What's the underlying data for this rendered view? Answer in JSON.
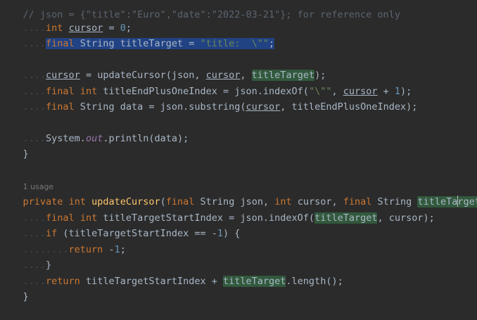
{
  "editor": {
    "language": "java",
    "colors": {
      "background": "#2b2b2b",
      "keyword": "#cc7832",
      "string": "#6a8759",
      "number": "#6897bb",
      "method": "#ffc66d",
      "selection": "#214283",
      "usage_highlight": "#32593d"
    },
    "lines": {
      "l0": "// json = {\"title\":\"Euro\",\"date\":\"2022-03-21\"}; for reference only",
      "l1": {
        "kw": "int",
        "var": "cursor",
        "rest": " = ",
        "num": "0",
        "end": ";"
      },
      "l2": {
        "kw": "final",
        "type": " String titleTarget = ",
        "str": "\"title:  \\\"\"",
        "end": ";"
      },
      "l4": {
        "var1": "cursor",
        "mid": " = updateCursor(json, ",
        "var2": "cursor",
        "sep": ", ",
        "hl": "titleTarget",
        "end": ");"
      },
      "l5": {
        "kw1": "final",
        "kw2": "int",
        "rest": " titleEndPlusOneIndex = json.indexOf(",
        "str": "\"\\\"\"",
        "sep": ", ",
        "var": "cursor",
        "plus": " + ",
        "num": "1",
        "end": ");"
      },
      "l6": {
        "kw": "final",
        "rest": " String data = json.substring(",
        "var": "cursor",
        "end": ", titleEndPlusOneIndex);"
      },
      "l8": {
        "pre": "System.",
        "ital": "out",
        "post": ".println(data);"
      },
      "l9": "}",
      "usage": "1 usage",
      "l11": {
        "kw1": "private",
        "kw2": "int",
        "fn": "updateCursor",
        "p1": "(",
        "kw3": "final",
        "p2": " String json, ",
        "kw4": "int",
        "p3": " cursor, ",
        "kw5": "final",
        "p4": " String ",
        "hl_a": "titleTa",
        "hl_b": "rget",
        "end": ") {"
      },
      "l12": {
        "kw1": "final",
        "kw2": "int",
        "rest": " titleTargetStartIndex = json.indexOf(",
        "hl": "titleTarget",
        "end": ", cursor);"
      },
      "l13": {
        "kw": "if",
        "rest": " (titleTargetStartIndex == -",
        "num": "1",
        "end": ") {"
      },
      "l14": {
        "kw": "return",
        "rest": " -",
        "num": "1",
        "end": ";"
      },
      "l15": "}",
      "l16": {
        "kw": "return",
        "rest": " titleTargetStartIndex + ",
        "hl": "titleTarget",
        "end": ".length();"
      },
      "l17": "}"
    },
    "guide": "....",
    "guide2": "........"
  }
}
